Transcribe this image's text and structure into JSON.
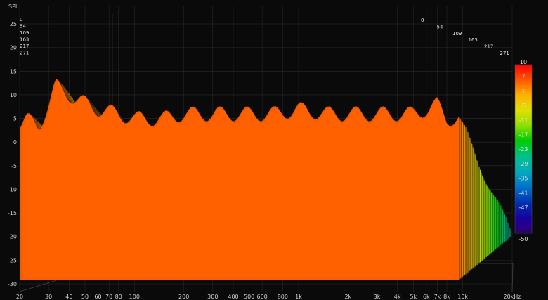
{
  "chart_data": {
    "type": "waterfall",
    "ylabel": "SPL",
    "x_unit_label": "kHz",
    "x_ticks": [
      {
        "v": 20,
        "label": "20"
      },
      {
        "v": 30,
        "label": "30"
      },
      {
        "v": 40,
        "label": "40"
      },
      {
        "v": 50,
        "label": "50"
      },
      {
        "v": 60,
        "label": "60"
      },
      {
        "v": 70,
        "label": "70"
      },
      {
        "v": 80,
        "label": "80"
      },
      {
        "v": 100,
        "label": "100"
      },
      {
        "v": 200,
        "label": "200"
      },
      {
        "v": 300,
        "label": "300"
      },
      {
        "v": 400,
        "label": "400"
      },
      {
        "v": 500,
        "label": "500"
      },
      {
        "v": 600,
        "label": "600"
      },
      {
        "v": 800,
        "label": "800"
      },
      {
        "v": 1000,
        "label": "1k"
      },
      {
        "v": 2000,
        "label": "2k"
      },
      {
        "v": 3000,
        "label": "3k"
      },
      {
        "v": 4000,
        "label": "4k"
      },
      {
        "v": 5000,
        "label": "5k"
      },
      {
        "v": 6000,
        "label": "6k"
      },
      {
        "v": 7000,
        "label": "7k"
      },
      {
        "v": 8000,
        "label": "8k"
      },
      {
        "v": 10000,
        "label": "10k"
      },
      {
        "v": 20000,
        "label": "20kHz"
      }
    ],
    "xlim": [
      20,
      20000
    ],
    "y_ticks": [
      25,
      20,
      15,
      10,
      5,
      0,
      -5,
      -10,
      -15,
      -20,
      -25,
      -30
    ],
    "ylim": [
      -31,
      28
    ],
    "time_ticks": [
      "0",
      "54",
      "109",
      "163",
      "217",
      "271"
    ],
    "colorbar": {
      "ticks": [
        "10",
        "7",
        "1",
        "-5",
        "-11",
        "-17",
        "-23",
        "-29",
        "-35",
        "-41",
        "-47",
        "-50"
      ],
      "range": [
        -50,
        10
      ],
      "colors": [
        "#ff0000",
        "#ff6600",
        "#ffc000",
        "#e8e800",
        "#8fe000",
        "#00cc00",
        "#00c080",
        "#00a0c0",
        "#0070c0",
        "#0020a0",
        "#1000a0",
        "#300080"
      ]
    },
    "series": {
      "first_slice_peaks_freq": [
        20,
        22,
        26,
        33,
        36,
        45,
        60,
        80,
        100,
        150,
        200,
        300,
        500,
        700,
        1000,
        1500,
        2000,
        3000,
        4000,
        5000,
        6000,
        7000,
        8000
      ],
      "first_slice_peaks_spl": [
        4,
        5,
        3,
        12,
        11,
        9,
        7,
        6,
        5,
        5,
        6,
        6,
        6,
        6,
        7,
        6,
        6,
        6,
        6,
        6,
        7,
        8,
        5
      ],
      "slice_count": 52,
      "floor_spl": -26
    }
  }
}
